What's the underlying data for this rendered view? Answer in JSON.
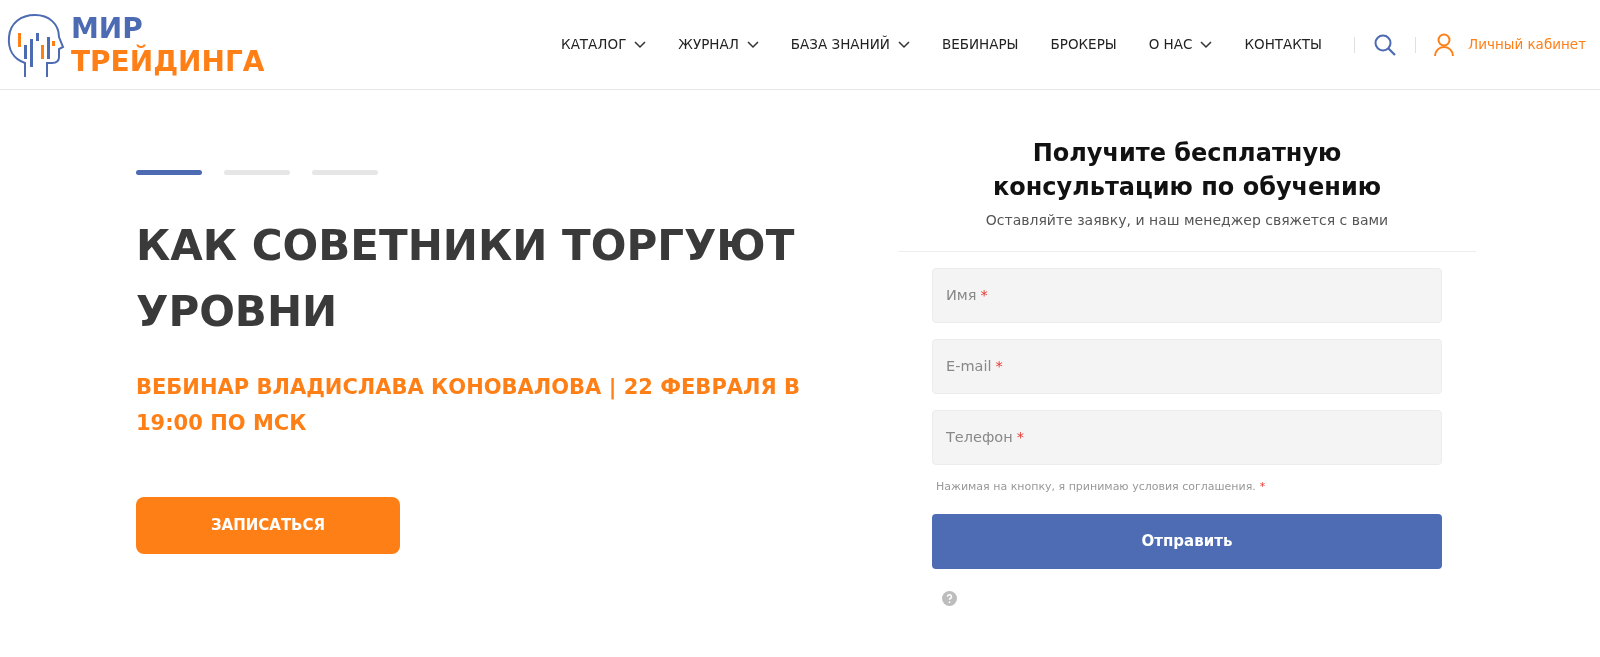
{
  "header": {
    "logo": {
      "line1": "МИР",
      "line2": "ТРЕЙДИНГА"
    },
    "nav": [
      {
        "label": "КАТАЛОГ",
        "dropdown": true
      },
      {
        "label": "ЖУРНАЛ",
        "dropdown": true
      },
      {
        "label": "БАЗА ЗНАНИЙ",
        "dropdown": true
      },
      {
        "label": "ВЕБИНАРЫ",
        "dropdown": false
      },
      {
        "label": "БРОКЕРЫ",
        "dropdown": false
      },
      {
        "label": "О НАС",
        "dropdown": true
      },
      {
        "label": "КОНТАКТЫ",
        "dropdown": false
      }
    ],
    "account": "Личный кабинет"
  },
  "hero": {
    "slides": [
      {
        "selected": true
      },
      {
        "selected": false
      },
      {
        "selected": false
      }
    ],
    "title": "КАК СОВЕТНИКИ ТОРГУЮТ УРОВНИ",
    "subtitle": "ВЕБИНАР ВЛАДИСЛАВА КОНОВАЛОВА | 22 ФЕВРАЛЯ В 19:00 ПО МСК",
    "button": "ЗАПИСАТЬСЯ"
  },
  "form": {
    "title": "Получите бесплатную консультацию по обучению",
    "subtitle": "Оставляйте заявку, и наш менеджер свяжется с вами",
    "fields": [
      {
        "placeholder": "Имя",
        "mark": "*"
      },
      {
        "placeholder": "E-mail",
        "mark": "*"
      },
      {
        "placeholder": "Телефон",
        "mark": "*"
      }
    ],
    "consent": "Нажимая на кнопку, я принимаю условия соглашения.",
    "consent_mark": "*",
    "submit": "Отправить"
  }
}
